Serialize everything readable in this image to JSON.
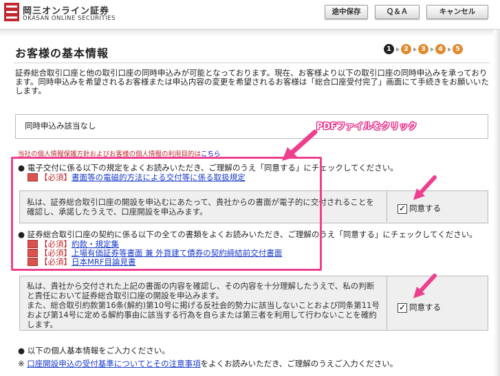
{
  "header": {
    "logo_jp": "岡三オンライン証券",
    "logo_en": "OKASAN ONLINE SECURITIES",
    "buttons": {
      "save": "途中保存",
      "qa": "Ｑ＆Ａ",
      "cancel": "キャンセル"
    }
  },
  "page": {
    "title": "お客様の基本情報",
    "steps": [
      "1",
      "2",
      "3",
      "4",
      "5"
    ],
    "current_step": 1
  },
  "intro": "証券総合取引口座と他の取引口座の同時申込みが可能となっております。現在、お客様より以下の取引口座の同時申込みを承っております。同時申込みを希望されるお客様または申込内容の変更を希望されるお客様は「総合口座受付完了」画面にて手続きをお願いいたします。",
  "notice": "同時申込み該当なし",
  "privacy": {
    "text": "当社の個人情報保護方針およびお客様の個人情報の利用目的は",
    "link": "こちら"
  },
  "annotation": "PDFファイルをクリック",
  "section1": {
    "bullet": "電子交付に係る以下の規定をよくお読みいただき、ご理解のうえ「同意する」にチェックしてください。",
    "docs": [
      {
        "required": "【必須】",
        "title": "書面等の電磁的方法による交付等に係る取扱規定"
      }
    ],
    "confirm": "私は、証券総合取引口座の開設を申込むにあたって、貴社からの書面が電子的に交付されることを確認し、承諾したうえで、口座開設を申込みます。",
    "agree": "同意する"
  },
  "section2": {
    "bullet": "証券総合取引口座の契約に係る以下の全ての書類をよくお読みいただき、ご理解のうえ「同意する」にチェックしてください。",
    "docs": [
      {
        "required": "【必須】",
        "title": "約款・規定集"
      },
      {
        "required": "【必須】",
        "title": "上場有価証券等書面 兼 外貨建て債券の契約締結前交付書面"
      },
      {
        "required": "【必須】",
        "title": "日本MRF目論見書"
      }
    ],
    "confirm_lines": [
      "私は、貴社から交付された上記の書面の内容を確認し、その内容を十分理解したうえで、私の判断と責任において証券総合取引口座の開設を申込みます。",
      "また、総合取引約款第16条(解約)第10号に掲げる反社会的勢力に該当しないことおよび同条第11号および第14号に定める解約事由に該当する行為を自らまたは第三者を利用して行わないことを確約します。"
    ],
    "agree": "同意する"
  },
  "footer": {
    "bullet": "以下の個人基本情報をご入力ください。",
    "note_mark": "※",
    "note_link": "口座開設申込の受付基準についてとその注意事項",
    "note_rest": "をよくお読みいただき、ご理解のうえご入力ください。"
  },
  "colors": {
    "accent_red": "#c1272d",
    "highlight_pink": "#ee3f8f",
    "link_blue": "#1a3cc8",
    "step_active": "#222222",
    "step_inactive": "#e08a2e"
  },
  "icons": [
    "okasan-logo-icon",
    "pdf-icon",
    "checkbox-checked-icon",
    "pointer-arrow-icon"
  ]
}
